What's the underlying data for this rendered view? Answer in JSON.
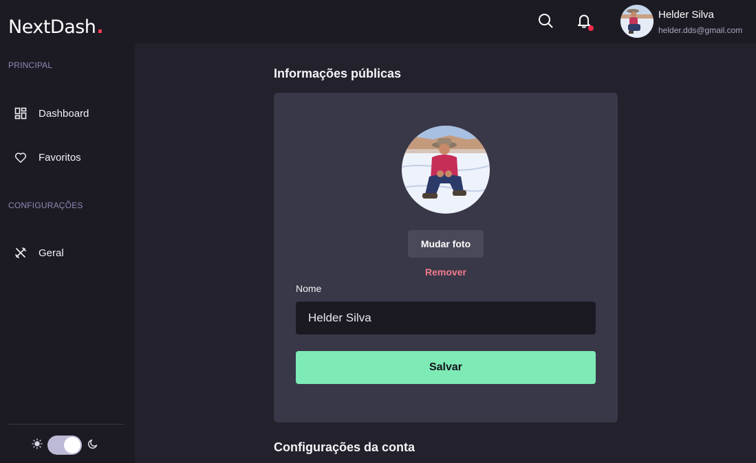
{
  "brand": {
    "name": "NextDash",
    "dot": "."
  },
  "sidebar": {
    "sections": [
      {
        "label": "PRINCIPAL"
      },
      {
        "label": "CONFIGURAÇÕES"
      }
    ],
    "items": [
      {
        "label": "Dashboard",
        "icon": "dashboard-grid-icon"
      },
      {
        "label": "Favoritos",
        "icon": "heart-icon"
      },
      {
        "label": "Geral",
        "icon": "tools-icon"
      }
    ],
    "theme": {
      "light_icon": "sun-icon",
      "dark_icon": "moon-icon",
      "mode": "dark"
    }
  },
  "header": {
    "search_icon": "search-icon",
    "notifications_icon": "bell-icon",
    "has_unread": true,
    "user": {
      "name": "Helder Silva",
      "email": "helder.dds@gmail.com"
    }
  },
  "profile": {
    "title": "Informações públicas",
    "change_photo_label": "Mudar foto",
    "remove_label": "Remover",
    "name_label": "Nome",
    "name_value": "Helder Silva",
    "save_label": "Salvar"
  },
  "account": {
    "title": "Configurações da conta"
  },
  "colors": {
    "background": "#22212c",
    "panel": "#1c1b24",
    "card": "#393849",
    "accent": "#7eeab6",
    "danger": "#f27a8c",
    "brand_dot": "#ff3b55"
  }
}
